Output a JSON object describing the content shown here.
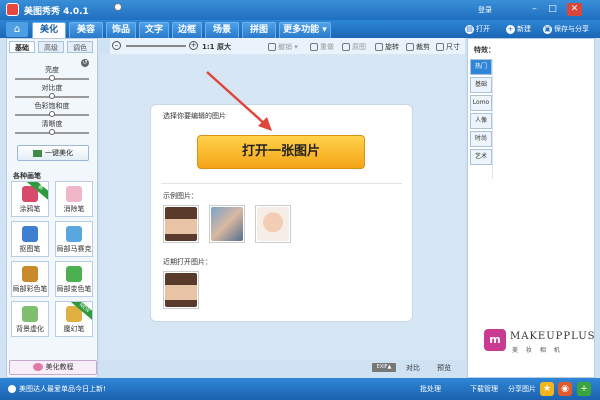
{
  "app": {
    "title": "美图秀秀 4.0.1",
    "login": "登录"
  },
  "window": {
    "minimize": "–",
    "maximize": "□",
    "close": "✕"
  },
  "menu": {
    "tabs": [
      {
        "label": "美化"
      },
      {
        "label": "美容"
      },
      {
        "label": "饰品"
      },
      {
        "label": "文字"
      },
      {
        "label": "边框"
      },
      {
        "label": "场景"
      },
      {
        "label": "拼图"
      },
      {
        "label": "更多功能 ▾"
      }
    ],
    "actions": {
      "open": "打开",
      "new": "新建",
      "save_share": "保存与分享"
    }
  },
  "toolbar": {
    "actual_size": "1:1 原大",
    "undo": "撤销",
    "redo": "重做",
    "original": "原图",
    "rotate": "旋转",
    "crop": "裁剪",
    "resize": "尺寸"
  },
  "left_panel": {
    "subtabs": [
      "基础",
      "高级",
      "调色"
    ],
    "sliders": [
      {
        "label": "亮度",
        "value": 0.5
      },
      {
        "label": "对比度",
        "value": 0.5
      },
      {
        "label": "色彩饱和度",
        "value": 0.5
      },
      {
        "label": "清晰度",
        "value": 0.5
      }
    ],
    "one_click": "一键美化",
    "section_title": "各种画笔",
    "pens": [
      {
        "label": "涂鸦笔",
        "badge": "新"
      },
      {
        "label": "消除笔",
        "badge": ""
      },
      {
        "label": "抠图笔",
        "badge": ""
      },
      {
        "label": "局部马赛克",
        "badge": ""
      },
      {
        "label": "局部彩色笔",
        "badge": ""
      },
      {
        "label": "局部变色笔",
        "badge": ""
      },
      {
        "label": "背景虚化",
        "badge": ""
      },
      {
        "label": "魔幻笔",
        "badge": "NEW"
      }
    ],
    "tutorial": "美化教程"
  },
  "canvas": {
    "prompt": "选择你要编辑的图片",
    "open_button": "打开一张图片",
    "samples_label": "示例图片：",
    "recent_label": "近期打开图片："
  },
  "right_panel": {
    "title": "特效：",
    "categories": [
      "热门",
      "基础",
      "Lomo",
      "人像",
      "时尚",
      "艺术"
    ],
    "brand": "MAKEUPPLUS",
    "brand_sub": "美 妆 相 机"
  },
  "footer": {
    "exif": "EXIF▲",
    "compare": "对比",
    "preview": "预览"
  },
  "statusbar": {
    "news": "美图达人最爱单品今日上新!",
    "batch": "批处理",
    "download": "下载管理",
    "share": "分享图片"
  },
  "colors": {
    "accent": "#1f6fc0",
    "open_button": "#f4a418",
    "arrow": "#e0453a"
  }
}
